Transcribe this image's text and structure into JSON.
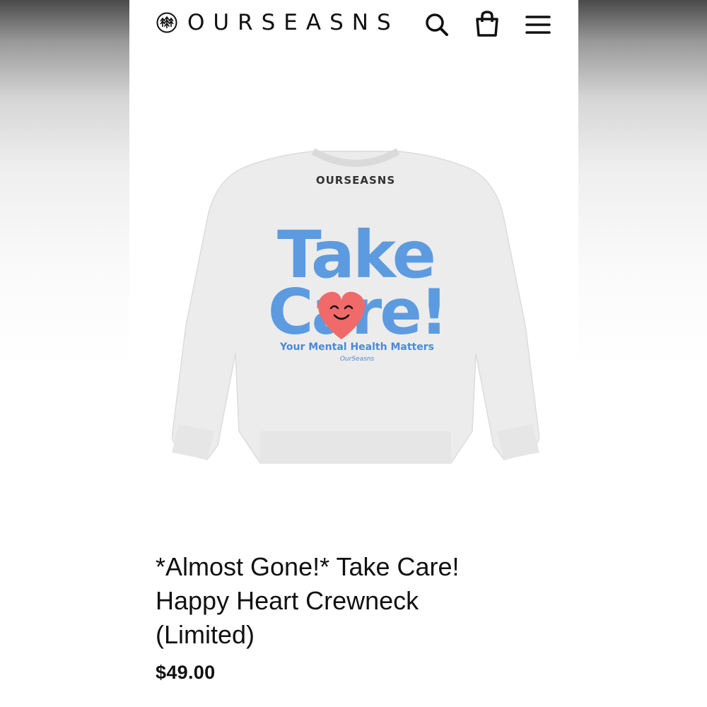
{
  "header": {
    "brand": "OURSEASNS",
    "icons": [
      "tree-logo-icon",
      "search-icon",
      "shopping-bag-icon",
      "hamburger-menu-icon"
    ]
  },
  "product": {
    "image": {
      "neck_label": "OURSEASNS",
      "print_line1": "Take",
      "print_line2": "Care!",
      "print_tagline": "Your Mental Health Matters",
      "print_signature": "OurSeasns"
    },
    "title_lines": [
      "*Almost Gone!* Take Care!",
      "Happy Heart Crewneck",
      "(Limited)"
    ],
    "price": "$49.00"
  },
  "colors": {
    "print_blue": "#5c9be0",
    "heart_pink": "#f06a6a",
    "sweater": "#ececec",
    "text": "#111111"
  }
}
